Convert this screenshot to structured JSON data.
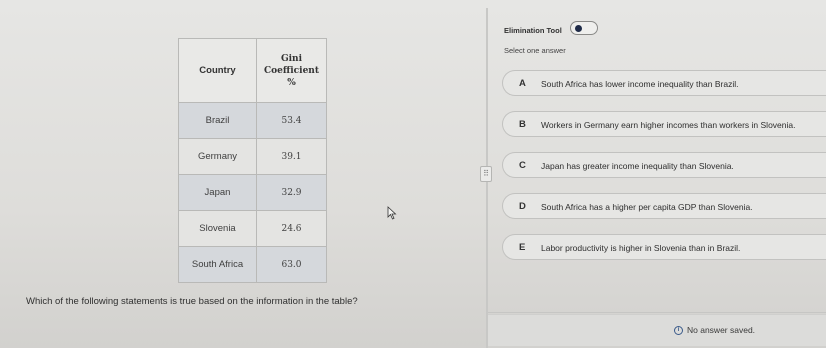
{
  "table": {
    "headers": [
      "Country",
      "Gini\nCoefficient\n%"
    ],
    "rows": [
      {
        "country": "Brazil",
        "gini": "53.4"
      },
      {
        "country": "Germany",
        "gini": "39.1"
      },
      {
        "country": "Japan",
        "gini": "32.9"
      },
      {
        "country": "Slovenia",
        "gini": "24.6"
      },
      {
        "country": "South Africa",
        "gini": "63.0"
      }
    ]
  },
  "question": "Which of the following statements is true based on the information in the table?",
  "elimination_tool": {
    "label": "Elimination Tool"
  },
  "select_prompt": "Select one answer",
  "options": [
    {
      "letter": "A",
      "text": "South Africa has lower income inequality than Brazil."
    },
    {
      "letter": "B",
      "text": "Workers in Germany earn higher incomes than workers in Slovenia."
    },
    {
      "letter": "C",
      "text": "Japan has greater income inequality than Slovenia."
    },
    {
      "letter": "D",
      "text": "South Africa has a higher per capita GDP than Slovenia."
    },
    {
      "letter": "E",
      "text": "Labor productivity is higher in Slovenia than in Brazil."
    }
  ],
  "status": {
    "icon": "info-icon",
    "text": "No answer saved."
  },
  "colors": {
    "toggle_knob": "#1f2b48",
    "info_accent": "#3a5a8a"
  }
}
